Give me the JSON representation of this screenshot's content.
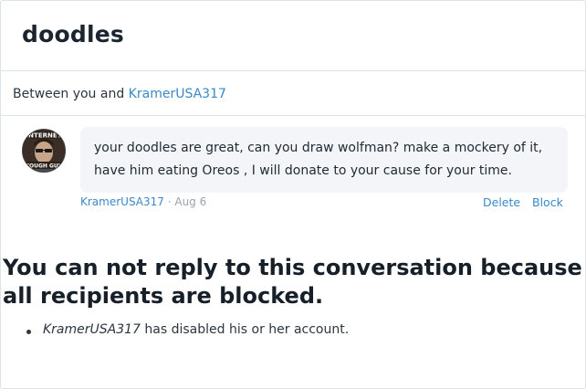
{
  "conversation": {
    "title": "doodles",
    "between_prefix": "Between you and ",
    "participant": "KramerUSA317"
  },
  "message": {
    "avatar_text_top": "INTERNET",
    "avatar_text_bottom": "TOUGH GUY",
    "text": "your doodles are great, can you draw wolfman? make a mockery of it, have him eating Oreos , I will donate to your cause for your time.",
    "author": "KramerUSA317",
    "date": "Aug 6",
    "separator": " · ",
    "delete_label": "Delete",
    "block_label": "Block"
  },
  "notice": {
    "heading": "You can not reply to this conversation because all recipients are blocked.",
    "reasons": [
      {
        "user": "KramerUSA317",
        "text": " has disabled his or her account."
      }
    ]
  }
}
